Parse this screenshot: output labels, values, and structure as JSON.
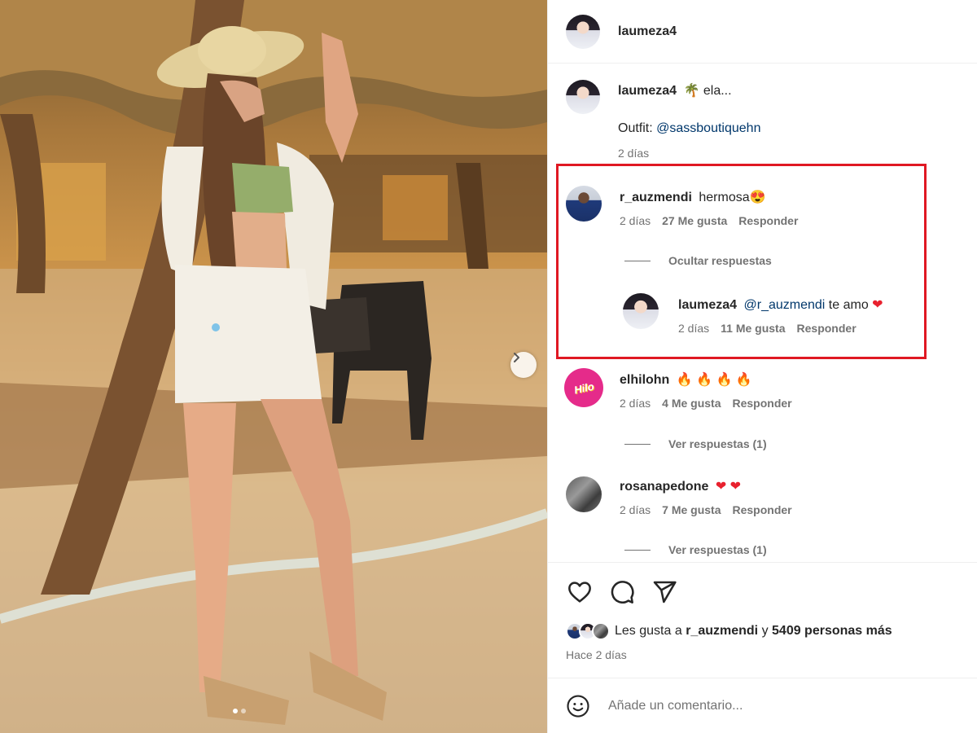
{
  "post": {
    "author": "laumeza4",
    "caption_user": "laumeza4",
    "caption_emoji": "🌴",
    "caption_text": "ela...",
    "outfit_label": "Outfit:",
    "outfit_mention": "@sassboutiquehn",
    "caption_time": "2 días"
  },
  "comments": [
    {
      "user": "r_auzmendi",
      "text": "hermosa",
      "emoji": "😍",
      "time": "2 días",
      "likes": "27 Me gusta",
      "reply_label": "Responder",
      "toggle_label": "Ocultar respuestas",
      "replies": [
        {
          "user": "laumeza4",
          "mention": "@r_auzmendi",
          "text": "te amo",
          "emoji": "❤",
          "time": "2 días",
          "likes": "11 Me gusta",
          "reply_label": "Responder"
        }
      ]
    },
    {
      "user": "elhilohn",
      "avatar_text": "Hilo",
      "emoji": "🔥 🔥 🔥 🔥",
      "time": "2 días",
      "likes": "4 Me gusta",
      "reply_label": "Responder",
      "toggle_label": "Ver respuestas (1)"
    },
    {
      "user": "rosanapedone",
      "emoji": "❤ ❤",
      "time": "2 días",
      "likes": "7 Me gusta",
      "reply_label": "Responder",
      "toggle_label": "Ver respuestas (1)"
    }
  ],
  "likes_summary": {
    "prefix": "Les gusta a",
    "user": "r_auzmendi",
    "middle": "y",
    "others": "5409 personas más"
  },
  "time_ago": "Hace 2 días",
  "add_comment": {
    "placeholder": "Añade un comentario..."
  },
  "colors": {
    "highlight": "#e01823",
    "mention": "#00376b",
    "muted": "#737373",
    "heart": "#e8212e"
  },
  "icons": [
    "heart-icon",
    "comment-icon",
    "share-icon",
    "emoji-icon",
    "chevron-right-icon"
  ]
}
